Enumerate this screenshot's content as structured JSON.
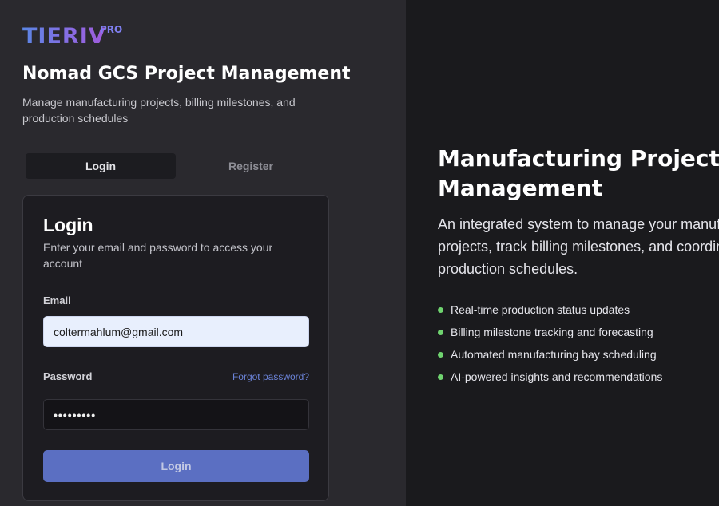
{
  "brand": {
    "name": "TIERIV",
    "badge": "PRO"
  },
  "app": {
    "title": "Nomad GCS Project Management",
    "subtitle": "Manage manufacturing projects, billing milestones, and production schedules"
  },
  "tabs": [
    {
      "label": "Login",
      "active": true
    },
    {
      "label": "Register",
      "active": false
    }
  ],
  "login_card": {
    "title": "Login",
    "subtitle": "Enter your email and password to access your account",
    "email_label": "Email",
    "email_value": "coltermahlum@gmail.com",
    "password_label": "Password",
    "forgot_label": "Forgot password?",
    "password_mask": "•••••••••",
    "submit_label": "Login"
  },
  "hero": {
    "title": "Manufacturing Project Management",
    "text": "An integrated system to manage your manufacturing projects, track billing milestones, and coordinate production schedules.",
    "features": [
      "Real-time production status updates",
      "Billing milestone tracking and forecasting",
      "Automated manufacturing bay scheduling",
      "AI-powered insights and recommendations"
    ],
    "bullet_color": "#6fd36f"
  },
  "colors": {
    "accent": "#5b6fc2",
    "link": "#6b83d8",
    "left_panel": "#2a292e",
    "right_panel": "#1a1a1d"
  }
}
